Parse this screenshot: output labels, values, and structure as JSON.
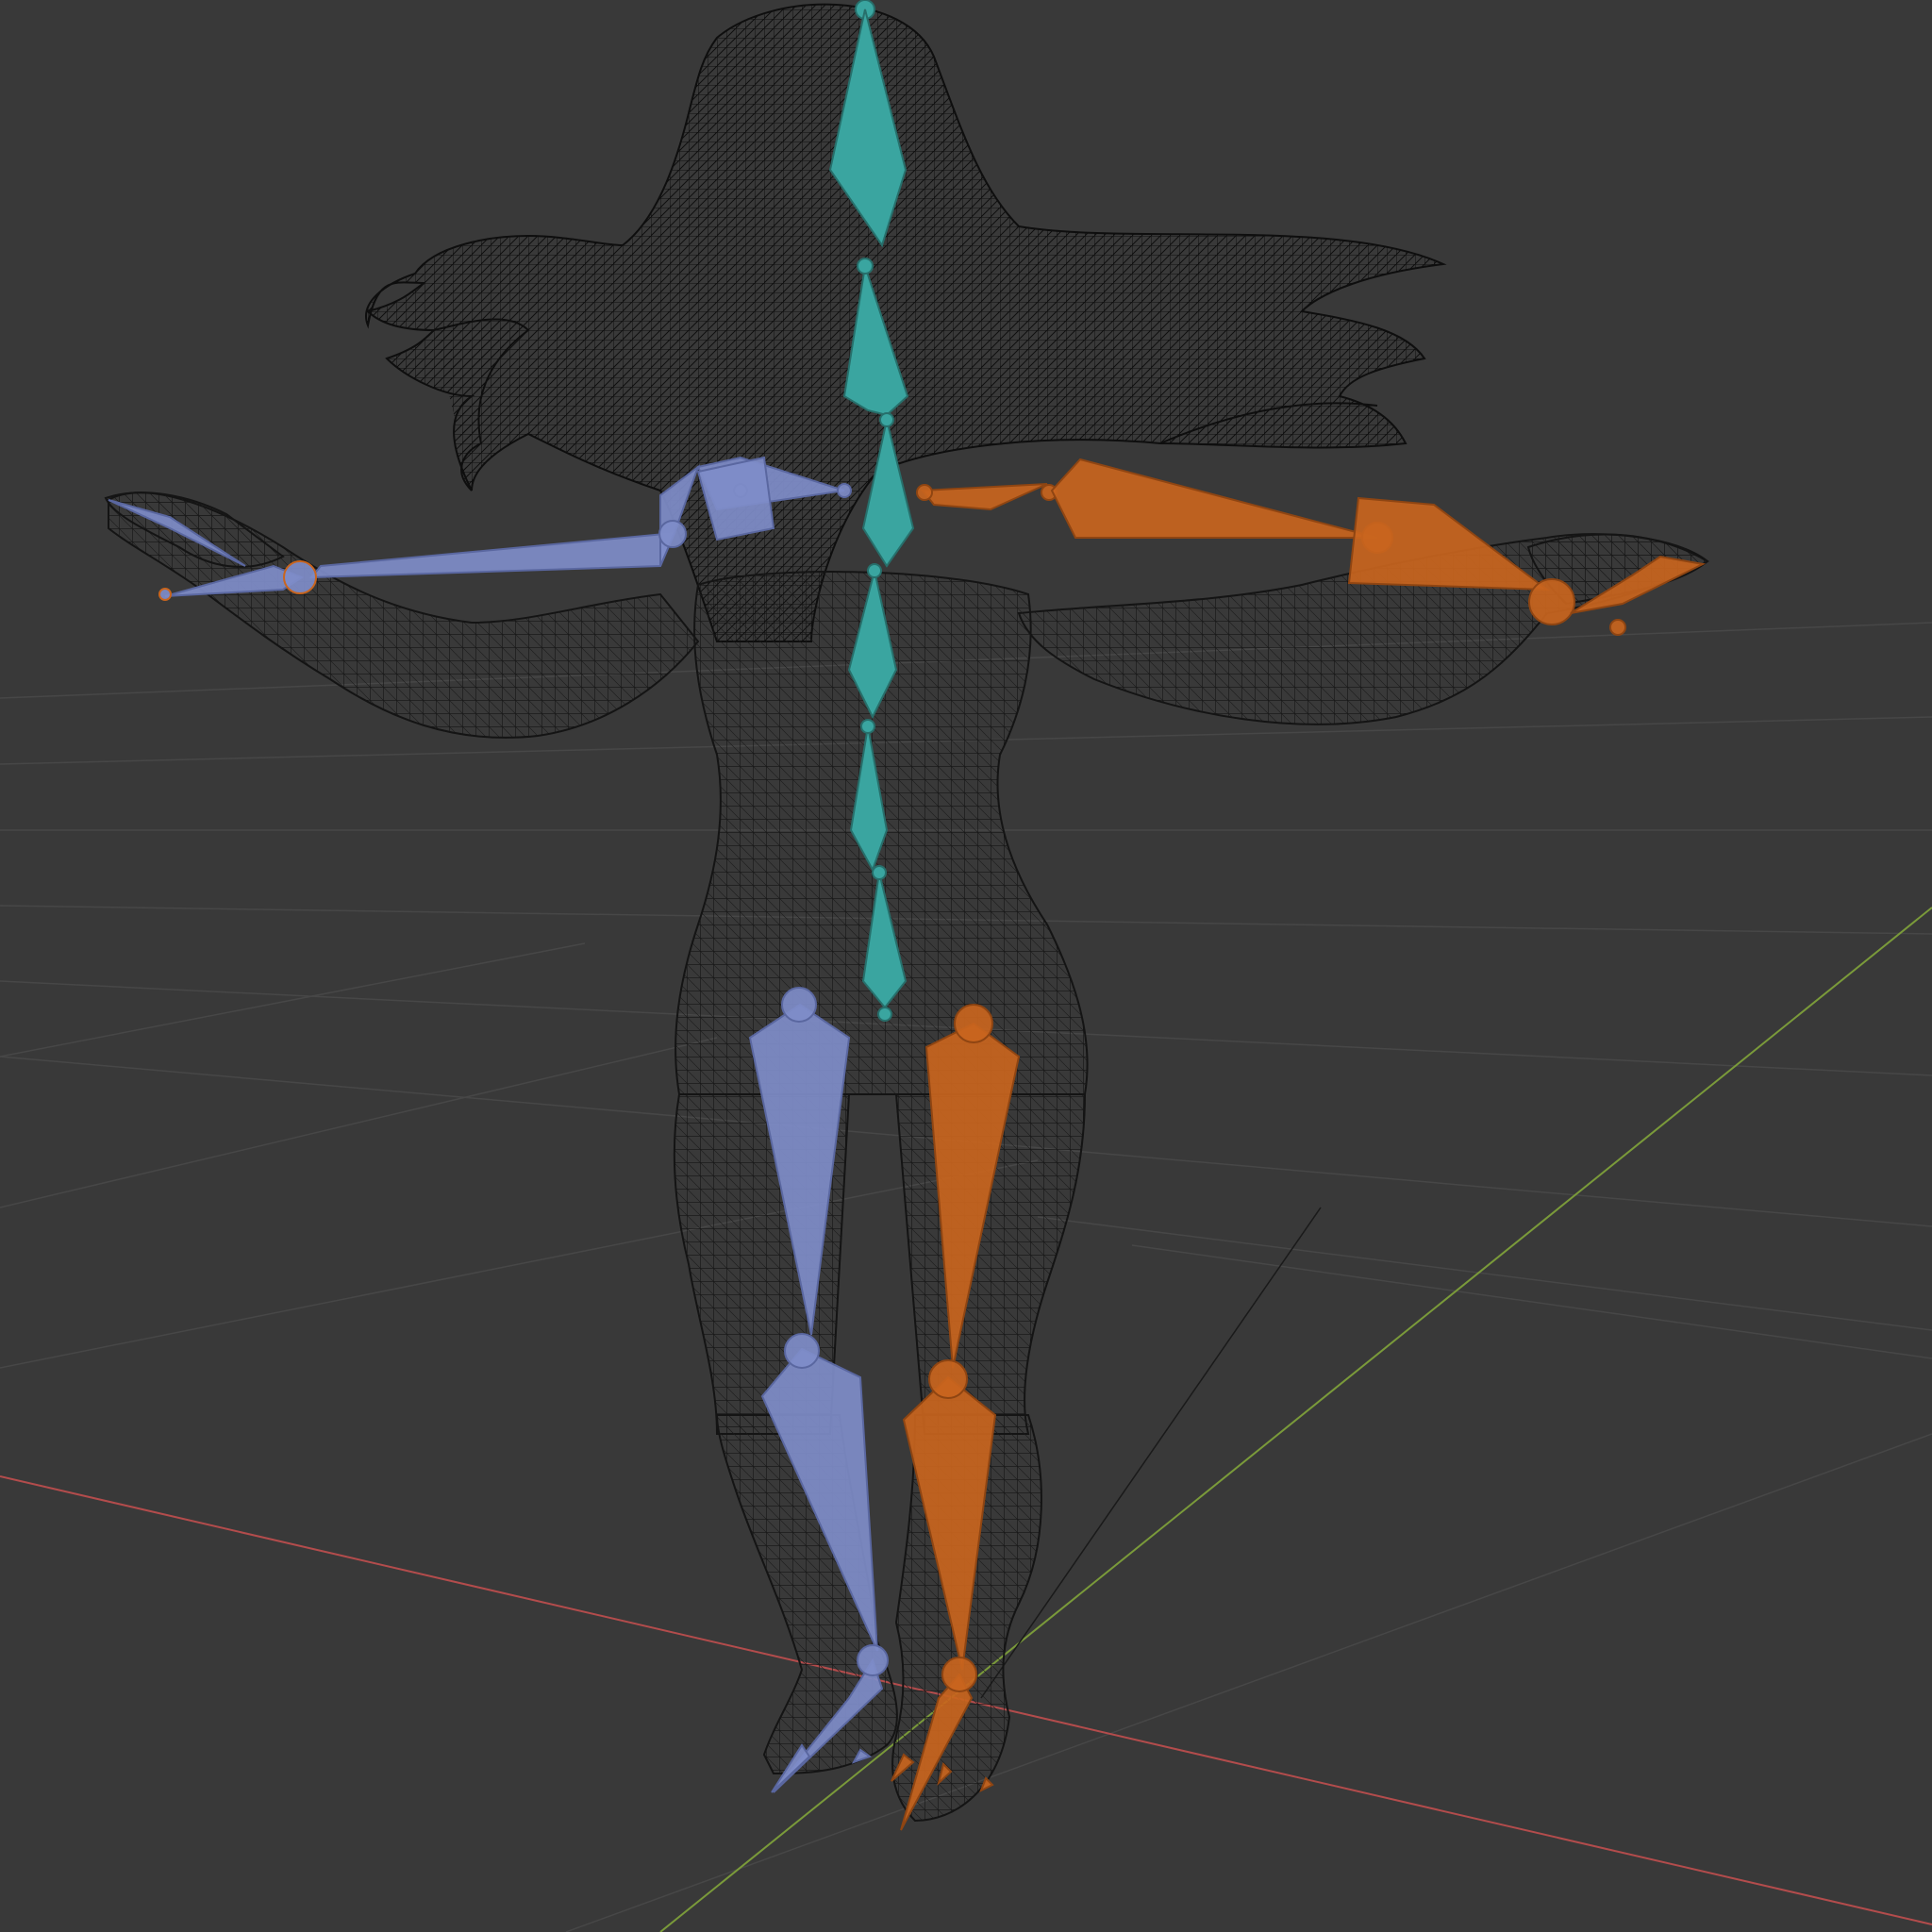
{
  "viewport": {
    "mode": "3d-viewport-pose-view",
    "background_color": "#393939",
    "grid_color": "#4a4a4a",
    "x_axis_color": "#b34c4c",
    "y_axis_color": "#7a9a3a"
  },
  "scene": {
    "object": "character-mesh-wireframe",
    "armature": "humanoid-armature",
    "wire_color": "#141414"
  },
  "bone_groups": {
    "center": {
      "color": "#3aa5a0",
      "edge": "#2b7d79"
    },
    "left": {
      "color": "#7f8dc9",
      "edge": "#5d6aa3"
    },
    "right": {
      "color": "#c9651e",
      "edge": "#9a4a12"
    }
  }
}
